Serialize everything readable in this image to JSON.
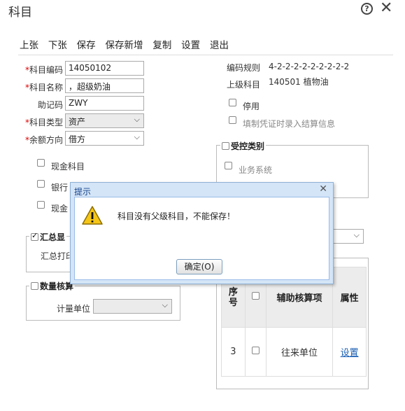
{
  "window": {
    "title": "科目",
    "help_glyph": "?",
    "close_glyph": "✕"
  },
  "toolbar": {
    "items": [
      "上张",
      "下张",
      "保存",
      "保存新增",
      "复制",
      "设置",
      "退出"
    ]
  },
  "form": {
    "code_label": "科目编码",
    "code_value": "14050102",
    "name_label": "科目名称",
    "name_value": "，超级奶油",
    "mnemonic_label": "助记码",
    "mnemonic_value": "ZWY",
    "type_label": "科目类型",
    "type_value": "资产",
    "balance_label": "余额方向",
    "balance_value": "借方",
    "required_mark": "*"
  },
  "rules": {
    "code_rule_label": "编码规则",
    "code_rule_value": "4-2-2-2-2-2-2-2-2-2",
    "parent_label": "上级科目",
    "parent_value": "140501 植物油"
  },
  "options": {
    "disable": "停用",
    "voucher_settle": "填制凭证时录入结算信息",
    "cash": "现金科目",
    "bank": "银行",
    "cash_eq": "现金"
  },
  "controlled": {
    "legend": "受控类别",
    "business": "业务系统"
  },
  "summary": {
    "legend": "汇总显",
    "print_label": "汇总打印"
  },
  "quantity": {
    "legend": "数量核算",
    "unit_label": "计量单位"
  },
  "aux_table": {
    "headers": [
      "序号",
      "",
      "辅助核算项",
      "属性"
    ],
    "rows": [
      {
        "seq": "3",
        "item": "往来单位",
        "attr": "设置"
      }
    ]
  },
  "dialog": {
    "title": "提示",
    "close_glyph": "✕",
    "message": "科目没有父级科目，不能保存！",
    "ok_label": "确定(O)"
  },
  "colors": {
    "dialog_bg": "#d4e5f7",
    "link": "#1a5fb4",
    "warning": "#f5c518"
  }
}
